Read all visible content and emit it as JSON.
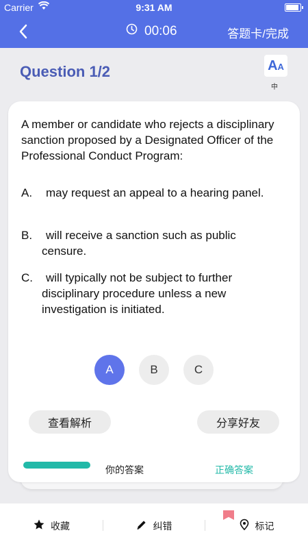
{
  "status_bar": {
    "carrier": "Carrier",
    "time": "9:31 AM"
  },
  "nav": {
    "timer": "00:06",
    "answer_card_label": "答题卡/完成"
  },
  "question": {
    "title": "Question 1/2",
    "font_button_label": "中",
    "stem": "A member or candidate who rejects a disciplinary sanction proposed by a Designated Officer of the Professional Conduct Program:",
    "options": [
      {
        "letter": "A.",
        "text": "may request an appeal to a hearing panel."
      },
      {
        "letter": "B.",
        "text": "will receive a sanction such as public censure."
      },
      {
        "letter": "C.",
        "text": "will typically not be subject to further disciplinary procedure unless a new investigation is initiated."
      }
    ],
    "answer_buttons": [
      "A",
      "B",
      "C"
    ],
    "selected": "A"
  },
  "actions": {
    "view_analysis": "查看解析",
    "share_friends": "分享好友"
  },
  "peek": {
    "text1": "你的答案",
    "text2": "正确答案"
  },
  "tabbar": {
    "favorite": "收藏",
    "report_error": "纠错",
    "mark": "标记"
  },
  "colors": {
    "primary": "#5470e6",
    "title": "#4a5cb5",
    "selected_answer": "#5f74ea",
    "teal": "#22b9a8",
    "bookmark": "#f07d8a"
  }
}
